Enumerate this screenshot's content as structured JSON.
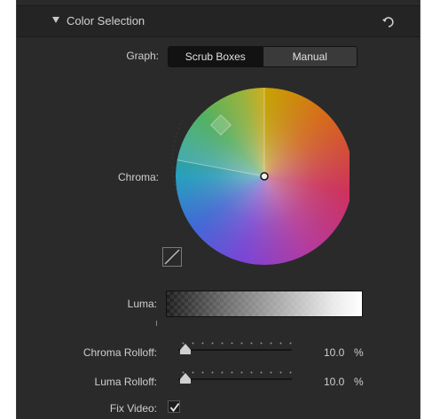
{
  "section": {
    "title": "Color Selection"
  },
  "graph": {
    "label": "Graph:",
    "options": [
      "Scrub Boxes",
      "Manual"
    ],
    "selected": "Scrub Boxes"
  },
  "chroma": {
    "label": "Chroma:"
  },
  "luma": {
    "label": "Luma:"
  },
  "chroma_rolloff": {
    "label": "Chroma Rolloff:",
    "value": "10.0",
    "unit": "%"
  },
  "luma_rolloff": {
    "label": "Luma Rolloff:",
    "value": "10.0",
    "unit": "%"
  },
  "fix_video": {
    "label": "Fix Video:",
    "checked": true
  },
  "colors": {
    "panel_bg": "#2a2a2a",
    "text": "#cfcfcf",
    "segment_active": "#121212",
    "segment_inactive": "#3a3a3a"
  }
}
